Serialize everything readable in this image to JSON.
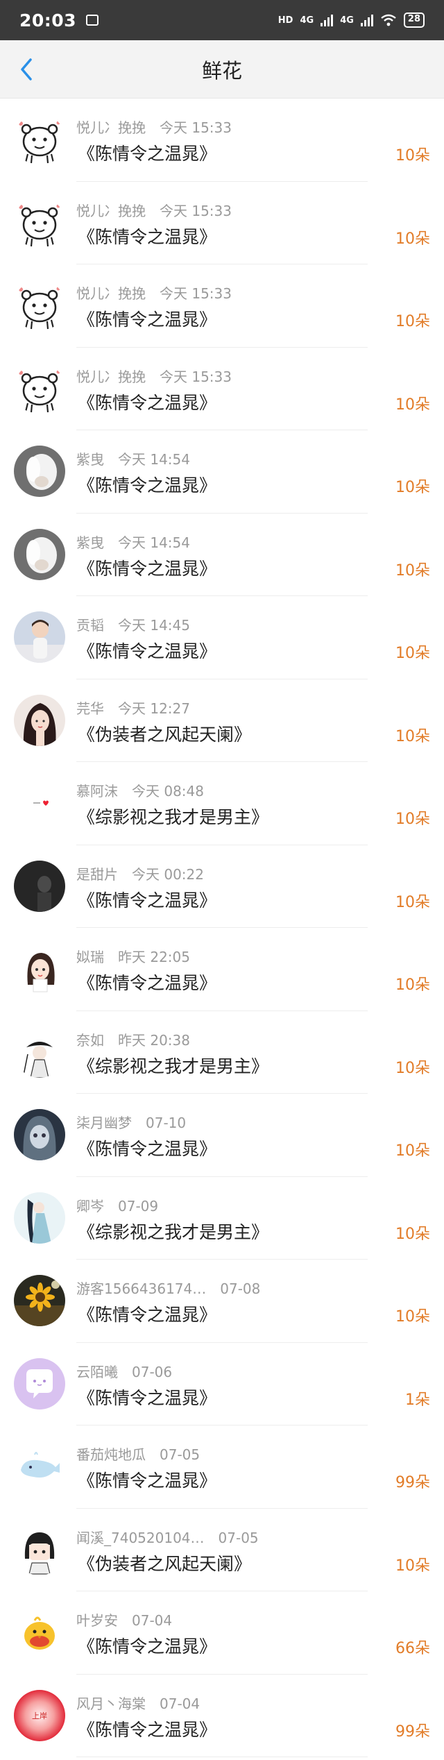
{
  "status_bar": {
    "time": "20:03",
    "network": "4G",
    "battery": "28"
  },
  "header": {
    "title": "鲜花"
  },
  "items": [
    {
      "name": "悦儿冫挽挽",
      "time": "今天 15:33",
      "title": "《陈情令之温晁》",
      "count": "10朵",
      "avatar": "bear"
    },
    {
      "name": "悦儿冫挽挽",
      "time": "今天 15:33",
      "title": "《陈情令之温晁》",
      "count": "10朵",
      "avatar": "bear"
    },
    {
      "name": "悦儿冫挽挽",
      "time": "今天 15:33",
      "title": "《陈情令之温晁》",
      "count": "10朵",
      "avatar": "bear"
    },
    {
      "name": "悦儿冫挽挽",
      "time": "今天 15:33",
      "title": "《陈情令之温晁》",
      "count": "10朵",
      "avatar": "bear"
    },
    {
      "name": "紫曳",
      "time": "今天 14:54",
      "title": "《陈情令之温晁》",
      "count": "10朵",
      "avatar": "white-hair"
    },
    {
      "name": "紫曳",
      "time": "今天 14:54",
      "title": "《陈情令之温晁》",
      "count": "10朵",
      "avatar": "white-hair"
    },
    {
      "name": "贡韬",
      "time": "今天 14:45",
      "title": "《陈情令之温晁》",
      "count": "10朵",
      "avatar": "boy"
    },
    {
      "name": "芫华",
      "time": "今天 12:27",
      "title": "《伪装者之风起天阑》",
      "count": "10朵",
      "avatar": "anime-girl"
    },
    {
      "name": "慕阿沫",
      "time": "今天 08:48",
      "title": "《综影视之我才是男主》",
      "count": "10朵",
      "avatar": "tiny-heart"
    },
    {
      "name": "是甜片",
      "time": "今天 00:22",
      "title": "《陈情令之温晁》",
      "count": "10朵",
      "avatar": "dark"
    },
    {
      "name": "姒瑞",
      "time": "昨天 22:05",
      "title": "《陈情令之温晁》",
      "count": "10朵",
      "avatar": "cartoon-girl"
    },
    {
      "name": "奈如",
      "time": "昨天 20:38",
      "title": "《综影视之我才是男主》",
      "count": "10朵",
      "avatar": "ink-figure"
    },
    {
      "name": "柒月幽梦",
      "time": "07-10",
      "title": "《陈情令之温晁》",
      "count": "10朵",
      "avatar": "doll"
    },
    {
      "name": "卿岑",
      "time": "07-09",
      "title": "《综影视之我才是男主》",
      "count": "10朵",
      "avatar": "hanfu"
    },
    {
      "name": "游客1566436174…",
      "time": "07-08",
      "title": "《陈情令之温晁》",
      "count": "10朵",
      "avatar": "sunflower"
    },
    {
      "name": "云陌曦",
      "time": "07-06",
      "title": "《陈情令之温晁》",
      "count": "1朵",
      "avatar": "bubble"
    },
    {
      "name": "番茄炖地瓜",
      "time": "07-05",
      "title": "《陈情令之温晁》",
      "count": "99朵",
      "avatar": "whale"
    },
    {
      "name": "闻溪_740520104…",
      "time": "07-05",
      "title": "《伪装者之风起天阑》",
      "count": "10朵",
      "avatar": "chibi"
    },
    {
      "name": "叶岁安",
      "time": "07-04",
      "title": "《陈情令之温晁》",
      "count": "66朵",
      "avatar": "yellow-bird"
    },
    {
      "name": "风月丶海棠",
      "time": "07-04",
      "title": "《陈情令之温晁》",
      "count": "99朵",
      "avatar": "red-glow"
    }
  ],
  "avatar_label": "上岸"
}
